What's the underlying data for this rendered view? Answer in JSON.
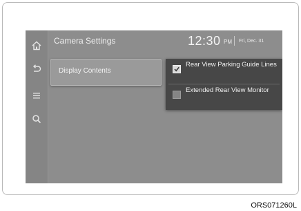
{
  "header": {
    "title": "Camera Settings",
    "time": "12:30",
    "ampm": "PM",
    "date": "Fri, Dec. 31"
  },
  "sidebar": {
    "icons": [
      "home-icon",
      "back-icon",
      "menu-icon",
      "search-icon"
    ]
  },
  "menu": {
    "display_contents_label": "Display Contents"
  },
  "options": [
    {
      "label": "Rear View Parking Guide Lines",
      "checked": true
    },
    {
      "label": "Extended Rear View Monitor",
      "checked": false
    }
  ],
  "caption": "ORS071260L",
  "colors": {
    "screen_bg": "#8d8d8d",
    "dropdown_bg": "#474747",
    "text": "#f0f0f0"
  }
}
